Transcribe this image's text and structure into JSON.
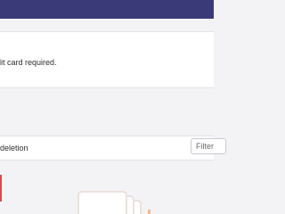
{
  "notice": {
    "text": "dit card required."
  },
  "toolbar": {
    "text": "deletion",
    "filter_placeholder": "Filter"
  },
  "illustration": {
    "name": "empty-state-cards-illustration"
  },
  "colors": {
    "header": "#3b3a78",
    "accent_red": "#d8494b",
    "illustration_line": "#ebe1dc",
    "illustration_accent": "#f6b98c"
  }
}
